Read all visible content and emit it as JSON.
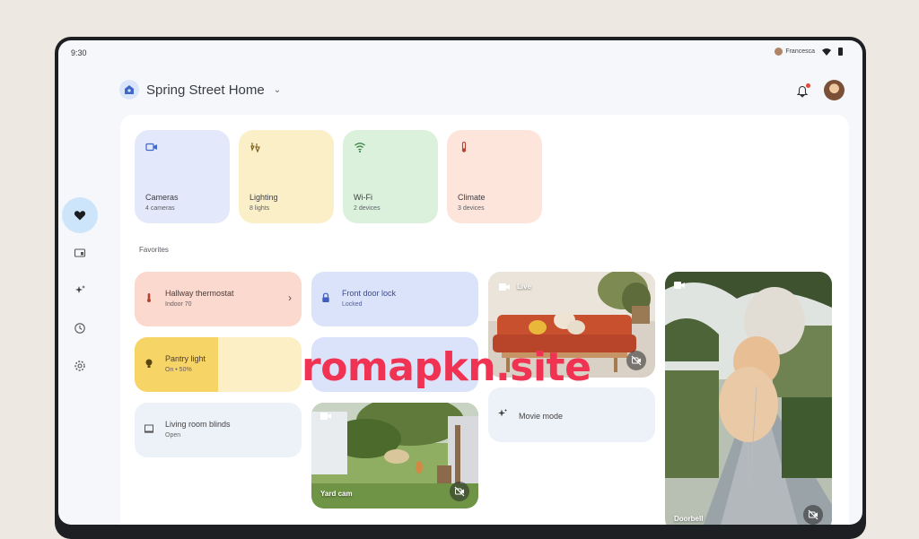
{
  "status": {
    "time": "9:30",
    "user": "Francesca"
  },
  "header": {
    "home_name": "Spring Street Home"
  },
  "nav": {
    "items": [
      "favorites-icon",
      "devices-icon",
      "automations-icon",
      "activity-icon",
      "settings-icon"
    ]
  },
  "categories": [
    {
      "name": "Cameras",
      "sub": "4 cameras",
      "color": "#e3e9fb",
      "icon": "camera-icon"
    },
    {
      "name": "Lighting",
      "sub": "8 lights",
      "color": "#fbefc8",
      "icon": "lighting-icon"
    },
    {
      "name": "Wi-Fi",
      "sub": "2 devices",
      "color": "#dcf1dc",
      "icon": "wifi-icon"
    },
    {
      "name": "Climate",
      "sub": "3 devices",
      "color": "#fde5dc",
      "icon": "thermometer-icon"
    }
  ],
  "favorites": {
    "label": "Favorites",
    "thermostat": {
      "title": "Hallway thermostat",
      "sub": "Indoor 70"
    },
    "lock": {
      "title": "Front door lock",
      "sub": "Locked"
    },
    "pantry_light": {
      "title": "Pantry light",
      "sub": "On • 50%",
      "level": 0.5
    },
    "blinds": {
      "title": "Living room blinds",
      "sub": "Open"
    },
    "movie": {
      "title": "Movie mode"
    },
    "live_cam": {
      "label": "Live"
    },
    "yard_cam": {
      "label": "Yard cam"
    },
    "doorbell_cam": {
      "label": "Doorbell"
    }
  },
  "watermark": "romapkn.site"
}
